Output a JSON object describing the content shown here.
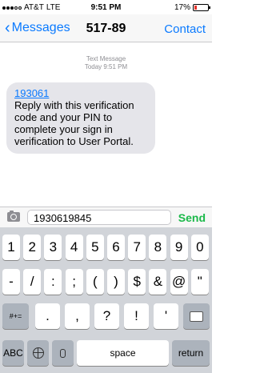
{
  "status": {
    "carrier": "AT&T",
    "network": "LTE",
    "time": "9:51 PM",
    "battery": "17%"
  },
  "nav": {
    "back_label": "Messages",
    "title": "517-89",
    "contact_label": "Contact"
  },
  "thread": {
    "meta_type": "Text Message",
    "meta_time": "Today 9:51 PM",
    "message": {
      "code": "193061",
      "body": "Reply with this verification code and your PIN to complete your sign in verification to User Portal."
    }
  },
  "composer": {
    "value": "1930619845",
    "send_label": "Send"
  },
  "keyboard": {
    "row1": [
      "1",
      "2",
      "3",
      "4",
      "5",
      "6",
      "7",
      "8",
      "9",
      "0"
    ],
    "row2": [
      "-",
      "/",
      ":",
      ";",
      "(",
      ")",
      "$",
      "&",
      "@",
      "\""
    ],
    "row3_left": "#+=",
    "row3": [
      ".",
      ",",
      "?",
      "!",
      "'"
    ],
    "abc": "ABC",
    "space": "space",
    "return": "return"
  },
  "colors": {
    "accent": "#0a7aff",
    "send": "#1bb94a",
    "bubble": "#e5e5ea",
    "keyboard_bg": "#d1d4d9"
  },
  "icons": [
    "signal-dots-icon",
    "battery-icon",
    "chevron-left-icon",
    "camera-icon",
    "delete-icon",
    "globe-icon",
    "mic-icon"
  ]
}
